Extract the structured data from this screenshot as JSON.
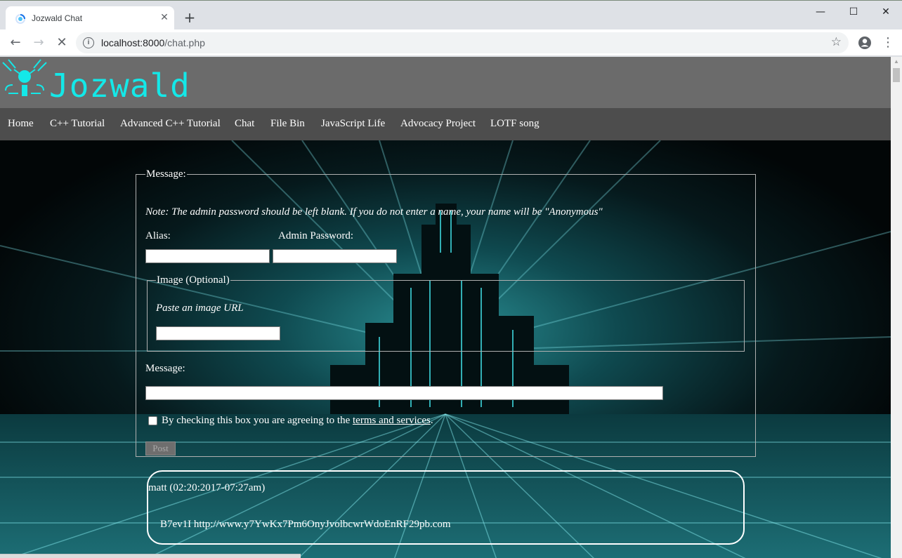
{
  "browser": {
    "tab_title": "Jozwald Chat",
    "url_host": "localhost:8000",
    "url_path": "/chat.php"
  },
  "site": {
    "logo_text": "Jozwald",
    "nav": [
      "Home",
      "C++ Tutorial",
      "Advanced C++ Tutorial",
      "Chat",
      "File Bin",
      "JavaScript Life",
      "Advocacy Project",
      "LOTF song"
    ]
  },
  "form": {
    "legend": "Message:",
    "note": "Note: The admin password should be left blank. If you do not enter a name, your name will be \"Anonymous\"",
    "alias_label": "Alias:",
    "alias_value": "",
    "password_label": "Admin Password:",
    "password_value": "",
    "image_legend": "Image (Optional)",
    "image_hint": "Paste an image URL",
    "image_value": "",
    "message_label": "Message:",
    "message_value": "",
    "agree_prefix": "By checking this box you are agreeing to the ",
    "terms_link": "terms and services",
    "agree_suffix": ".",
    "agree_checked": false,
    "post_button": "Post"
  },
  "posts": [
    {
      "author_line": "matt (02:20:2017-07:27am)",
      "body": "B7ev1I http://www.y7YwKx7Pm6OnyJvolbcwrWdoEnRF29pb.com"
    }
  ],
  "colors": {
    "logo": "#14e8e8",
    "header_bg": "#6b6b6b",
    "nav_bg": "#4d4d4d",
    "page_bg": "#000000"
  }
}
